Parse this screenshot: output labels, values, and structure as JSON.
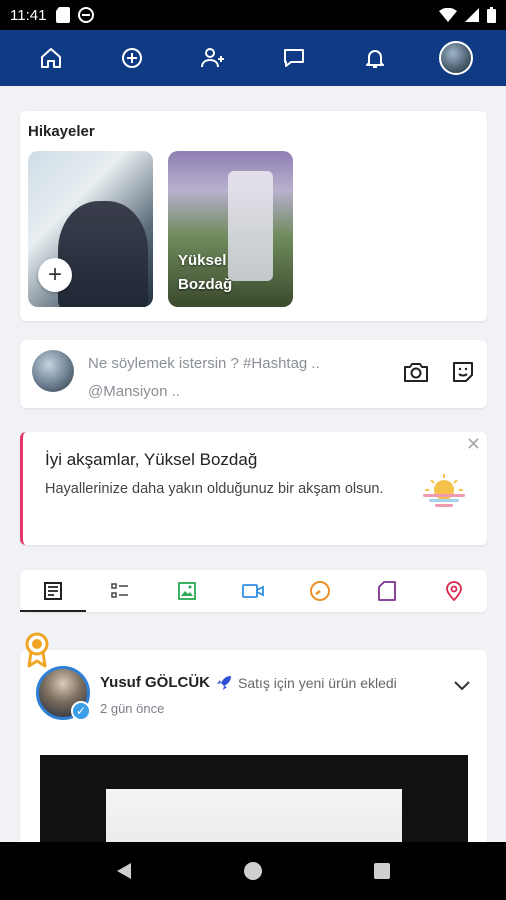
{
  "status_bar": {
    "time": "11:41"
  },
  "top_nav": {
    "icons": [
      "home-icon",
      "add-circle-icon",
      "add-user-icon",
      "message-icon",
      "bell-icon",
      "profile-avatar"
    ]
  },
  "stories": {
    "title": "Hikayeler",
    "items": [
      {
        "name": "",
        "type": "add-story"
      },
      {
        "name": "Yüksel Bozdağ",
        "type": "story"
      }
    ]
  },
  "composer": {
    "placeholder": "Ne söylemek istersin ? #Hashtag .. @Mansiyon .."
  },
  "greeting": {
    "title": "İyi akşamlar, Yüksel Bozdağ",
    "message": "Hayallerinize daha yakın olduğunuz bir akşam olsun."
  },
  "feed_tabs": [
    {
      "icon": "news-icon",
      "active": true
    },
    {
      "icon": "list-icon",
      "active": false
    },
    {
      "icon": "image-icon",
      "active": false
    },
    {
      "icon": "video-icon",
      "active": false
    },
    {
      "icon": "clock-icon",
      "active": false
    },
    {
      "icon": "file-icon",
      "active": false
    },
    {
      "icon": "location-pin-icon",
      "active": false
    }
  ],
  "post": {
    "author": "Yusuf GÖLCÜK",
    "action": "Satış için yeni ürün ekledi",
    "time": "2 gün önce"
  },
  "colors": {
    "nav_bg": "#0f3b85",
    "greeting_accent": "#e4366a",
    "tab_image": "#2aa853",
    "tab_video": "#2f8fe0",
    "tab_clock": "#e8912a",
    "tab_file": "#7a2f8f",
    "tab_location": "#d8264c"
  }
}
